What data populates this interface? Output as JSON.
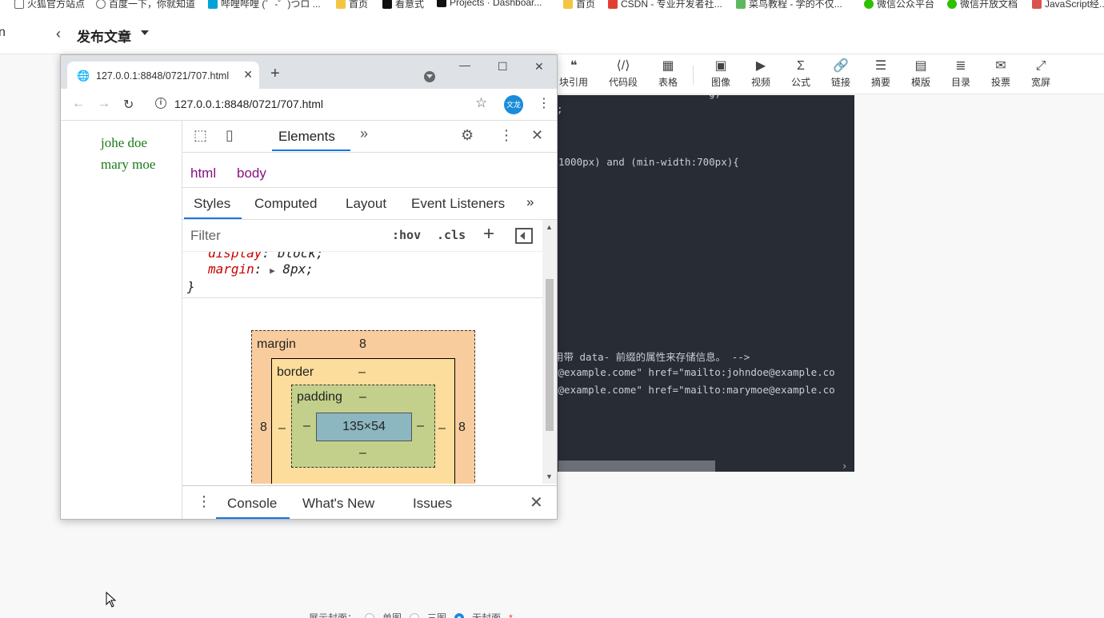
{
  "bookmarks": [
    {
      "label": "火狐官方站点",
      "icon": "square-icon",
      "color": "#666666"
    },
    {
      "label": "百度一下，你就知道",
      "icon": "globe-icon",
      "color": "#666666"
    },
    {
      "label": "哔哩哔哩 (゜-゜)つロ ...",
      "icon": "bilibili-icon",
      "color": "#00a1d6"
    },
    {
      "label": "首页",
      "icon": "folder-icon",
      "color": "#f4c542"
    },
    {
      "label": "看意式",
      "icon": "tiktok-icon",
      "color": "#111111"
    },
    {
      "label": "Projects · Dashboar...",
      "icon": "tiktok-icon",
      "color": "#111111"
    },
    {
      "label": "首页",
      "icon": "folder-icon",
      "color": "#f4c542"
    },
    {
      "label": "CSDN - 专业开发者社...",
      "icon": "csdn-icon",
      "color": "#e33e33"
    },
    {
      "label": "菜鸟教程 - 学的不仅...",
      "icon": "runoob-icon",
      "color": "#5fb85f"
    },
    {
      "label": "微信公众平台",
      "icon": "wechat-icon",
      "color": "#2dc100"
    },
    {
      "label": "微信开放文档",
      "icon": "wechat-icon",
      "color": "#2dc100"
    },
    {
      "label": "JavaScript经...",
      "icon": "js-icon",
      "color": "#d9534f"
    }
  ],
  "editor": {
    "edge_char": "n",
    "back": "‹",
    "title": "发布文章"
  },
  "toolbar": [
    {
      "label": "块引用",
      "icon": "quote-icon",
      "glyph": "❝"
    },
    {
      "label": "代码段",
      "icon": "code-icon",
      "glyph": "⟨/⟩"
    },
    {
      "label": "表格",
      "icon": "table-icon",
      "glyph": "▦"
    },
    {
      "label": "图像",
      "icon": "image-icon",
      "glyph": "▣"
    },
    {
      "label": "视频",
      "icon": "video-icon",
      "glyph": "▶"
    },
    {
      "label": "公式",
      "icon": "sigma-icon",
      "glyph": "Σ"
    },
    {
      "label": "链接",
      "icon": "link-icon",
      "glyph": "🔗"
    },
    {
      "label": "摘要",
      "icon": "summary-icon",
      "glyph": "☰"
    },
    {
      "label": "模版",
      "icon": "template-icon",
      "glyph": "▤"
    },
    {
      "label": "目录",
      "icon": "toc-icon",
      "glyph": "≣"
    },
    {
      "label": "投票",
      "icon": "vote-icon",
      "glyph": "✉"
    },
    {
      "label": "宽屏",
      "icon": "widescreen-icon",
      "glyph": "⤢"
    }
  ],
  "code_lines": [
    "g)",
    ";",
    "1000px) and (min-width:700px){",
    "用带 data- 前缀的属性来存储信息。 -->",
    "e@example.come\" href=\"mailto:johndoe@example.co",
    "e@example.come\" href=\"mailto:marymoe@example.co"
  ],
  "cover": {
    "label": "展示封面：",
    "options": [
      "单图",
      "三图",
      "无封面"
    ],
    "required": "*"
  },
  "popup": {
    "tab_title": "127.0.0.1:8848/0721/707.html",
    "url": "127.0.0.1:8848/0721/707.html",
    "ext_avatar": "文龙",
    "contacts": [
      "johe doe",
      "mary moe"
    ]
  },
  "devtools": {
    "main_tab": "Elements",
    "more": "»",
    "breadcrumbs": [
      "html",
      "body"
    ],
    "subtabs": [
      "Styles",
      "Computed",
      "Layout",
      "Event Listeners"
    ],
    "filter_placeholder": "Filter",
    "hov": ":hov",
    "cls": ".cls",
    "rules": {
      "display_prop": "display",
      "display_val": "block;",
      "margin_prop": "margin",
      "margin_val": "8px;",
      "close": "}"
    },
    "box_model": {
      "margin_label": "margin",
      "margin_top": "8",
      "margin_left": "8",
      "margin_right": "8",
      "border_label": "border",
      "border_top": "–",
      "border_left": "–",
      "border_right": "–",
      "border_bottom": "–",
      "padding_label": "padding",
      "padding_top": "–",
      "padding_left": "–",
      "padding_right": "–",
      "padding_bottom": "–",
      "content": "135×54"
    },
    "drawer_tabs": [
      "Console",
      "What's New",
      "Issues"
    ]
  }
}
